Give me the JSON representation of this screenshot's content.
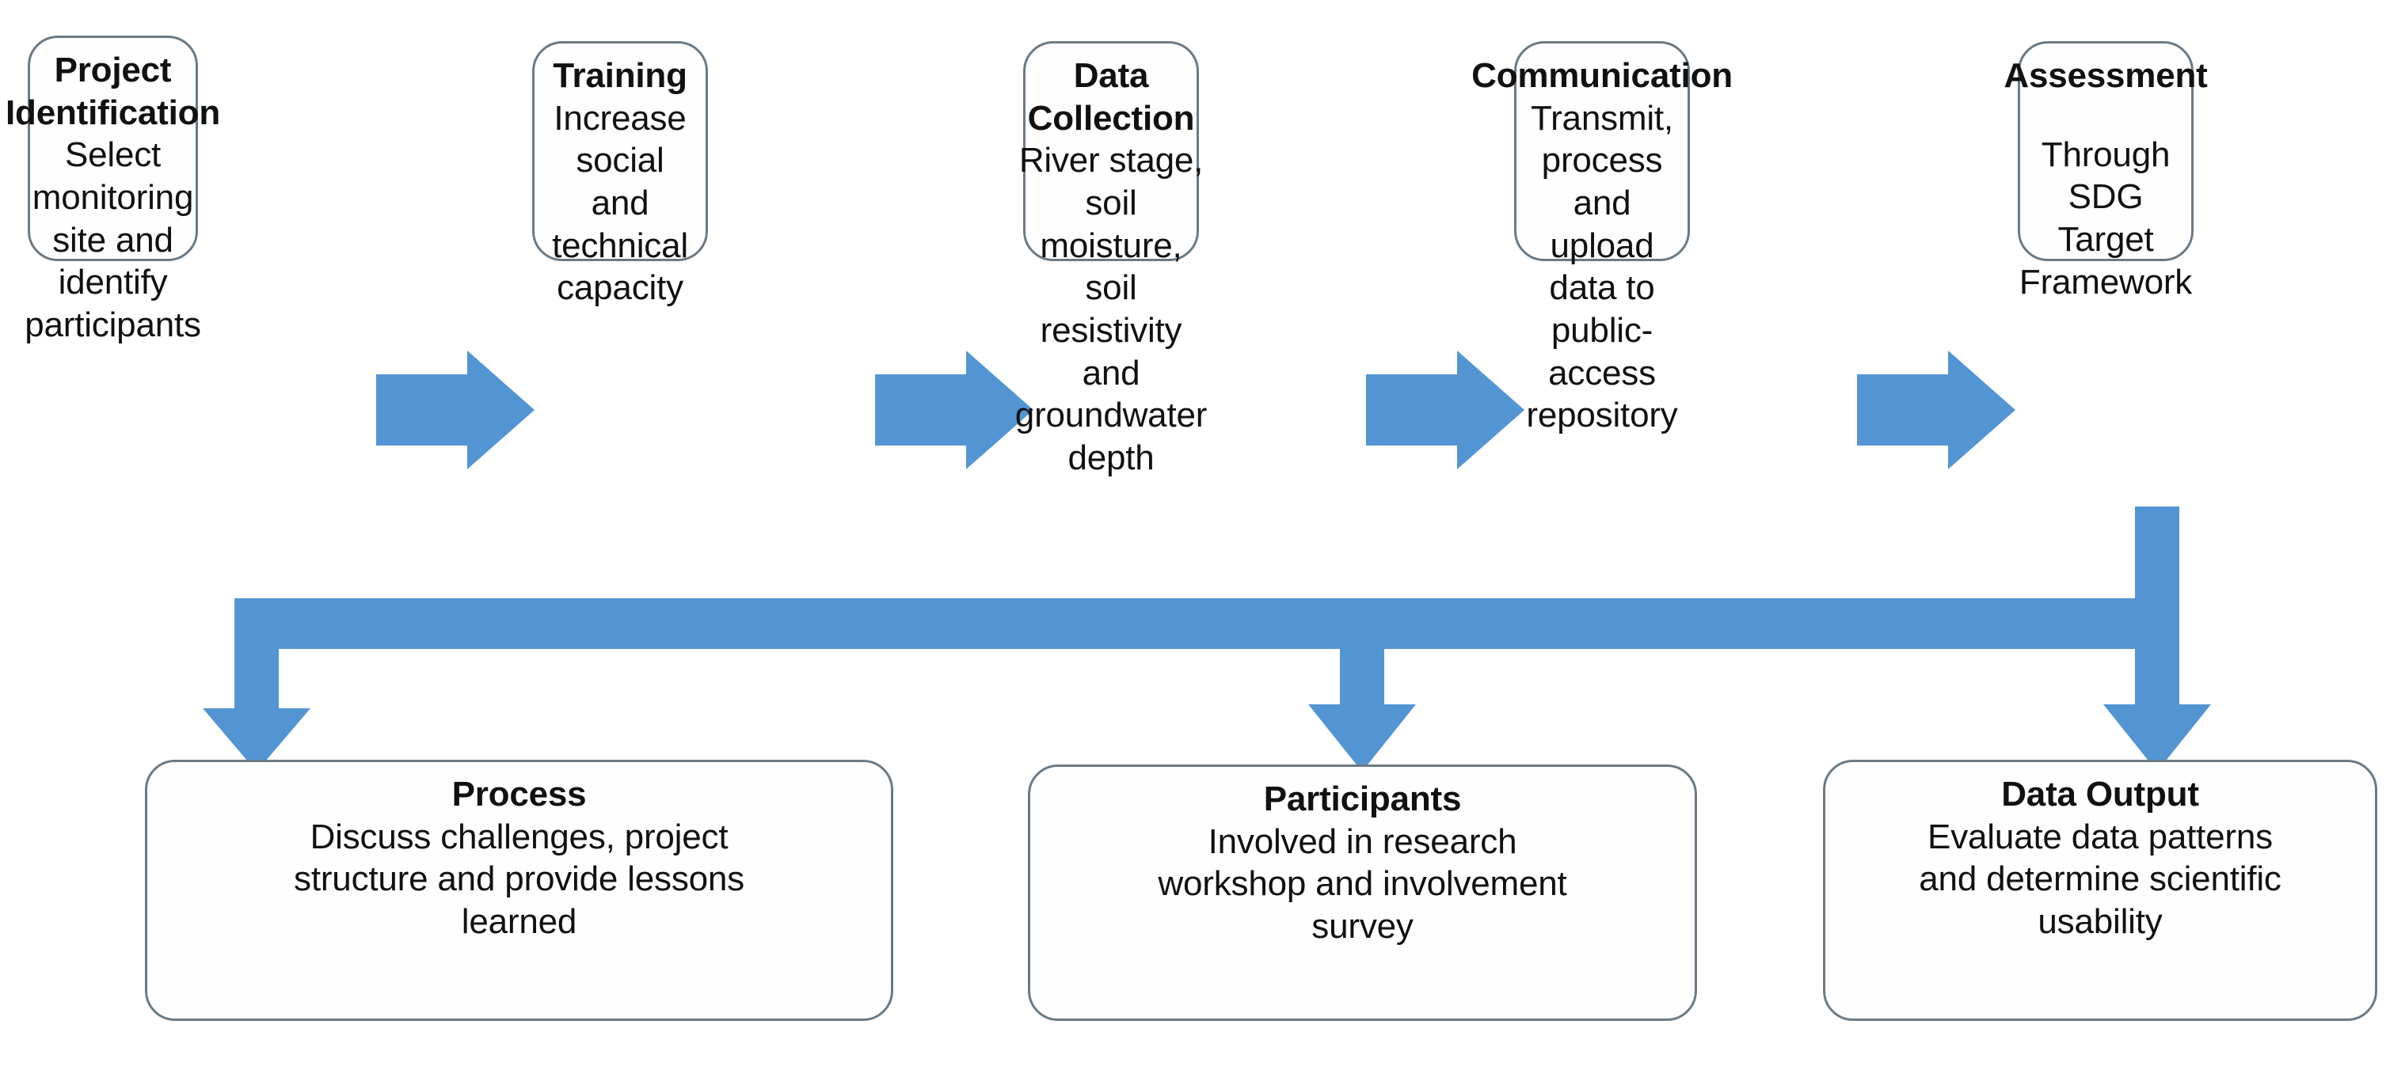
{
  "diagram": {
    "type": "flowchart",
    "accent_color": "#5395D3",
    "box_border_color": "#6B7A85",
    "box_fill_color": "#FEFEFE",
    "text_color": "#111111",
    "top_row": [
      {
        "id": "project-identification",
        "title": "Project\nIdentification",
        "body": "Select\nmonitoring\nsite and\nidentify\nparticipants"
      },
      {
        "id": "training",
        "title": "Training",
        "body": "Increase\nsocial and\ntechnical\ncapacity"
      },
      {
        "id": "data-collection",
        "title": "Data Collection",
        "body": "River stage,\nsoil moisture,\nsoil resistivity\nand\ngroundwater\ndepth"
      },
      {
        "id": "communication",
        "title": "Communication",
        "body": "Transmit,\nprocess and\nupload data to\npublic-access\nrepository"
      },
      {
        "id": "assessment",
        "title": "Assessment",
        "body": "Through SDG\nTarget\nFramework"
      }
    ],
    "bottom_row": [
      {
        "id": "process",
        "title": "Process",
        "body": "Discuss challenges, project\nstructure and provide lessons\nlearned"
      },
      {
        "id": "participants",
        "title": "Participants",
        "body": "Involved in research\nworkshop and involvement\nsurvey"
      },
      {
        "id": "data-output",
        "title": "Data Output",
        "body": "Evaluate data patterns\nand determine scientific\nusability"
      }
    ],
    "connectors": [
      {
        "id": "arrow-project-to-training",
        "kind": "block-arrow-right"
      },
      {
        "id": "arrow-training-to-collection",
        "kind": "block-arrow-right"
      },
      {
        "id": "arrow-collection-to-communication",
        "kind": "block-arrow-right"
      },
      {
        "id": "arrow-communication-to-assessment",
        "kind": "block-arrow-right"
      },
      {
        "id": "bus-assessment-to-bottom-row",
        "kind": "distribution-bus"
      },
      {
        "id": "arrow-bus-to-process",
        "kind": "block-arrow-down"
      },
      {
        "id": "arrow-bus-to-participants",
        "kind": "block-arrow-down"
      },
      {
        "id": "arrow-bus-to-data-output",
        "kind": "block-arrow-down"
      }
    ]
  }
}
